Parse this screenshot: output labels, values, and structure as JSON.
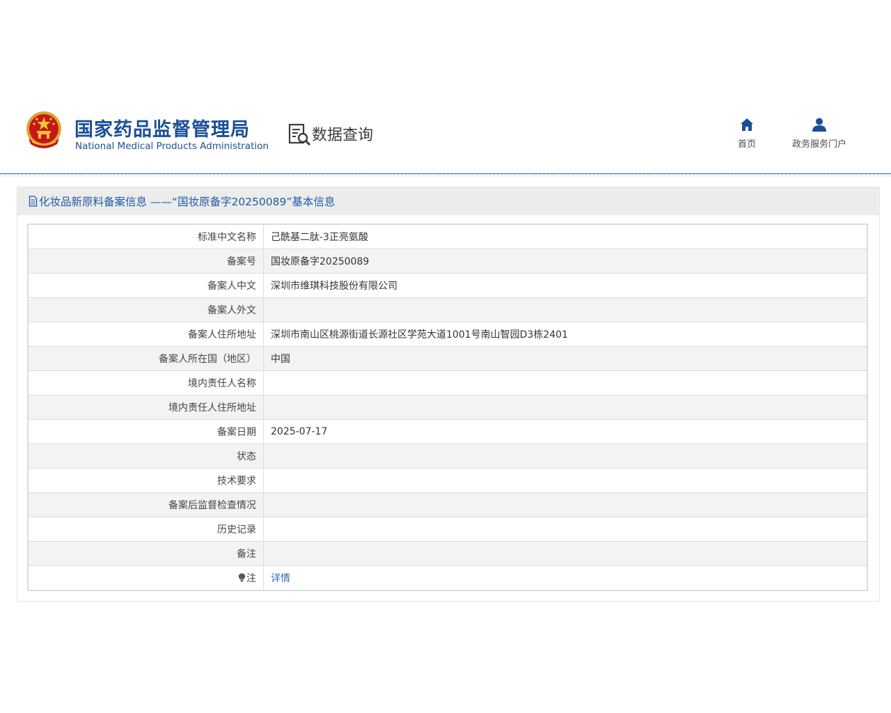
{
  "header": {
    "org_name_cn": "国家药品监督管理局",
    "org_name_en": "National Medical Products Administration",
    "section_title": "数据查询",
    "nav": {
      "home_label": "首页",
      "gov_service_label": "政务服务门户"
    }
  },
  "panel": {
    "title": "化妆品新原料备案信息 ——“国妆原备字20250089”基本信息"
  },
  "rows": [
    {
      "label": "标准中文名称",
      "value": "己酰基二肽-3正亮氨酸"
    },
    {
      "label": "备案号",
      "value": "国妆原备字20250089"
    },
    {
      "label": "备案人中文",
      "value": "深圳市维琪科技股份有限公司"
    },
    {
      "label": "备案人外文",
      "value": ""
    },
    {
      "label": "备案人住所地址",
      "value": "深圳市南山区桃源街道长源社区学苑大道1001号南山智园D3栋2401"
    },
    {
      "label": "备案人所在国（地区）",
      "value": "中国"
    },
    {
      "label": "境内责任人名称",
      "value": ""
    },
    {
      "label": "境内责任人住所地址",
      "value": ""
    },
    {
      "label": "备案日期",
      "value": "2025-07-17"
    },
    {
      "label": "状态",
      "value": ""
    },
    {
      "label": "技术要求",
      "value": ""
    },
    {
      "label": "备案后监督检查情况",
      "value": ""
    },
    {
      "label": "历史记录",
      "value": ""
    },
    {
      "label": "备注",
      "value": ""
    }
  ],
  "note_row": {
    "label": "注",
    "link_text": "详情"
  },
  "colors": {
    "brand_blue": "#1a4f97",
    "link_blue": "#2b6cc4",
    "title_blue": "#1f5aa6"
  }
}
